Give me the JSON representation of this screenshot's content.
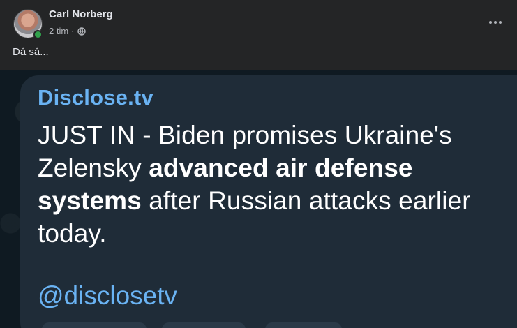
{
  "post": {
    "author": "Carl Norberg",
    "time": "2 tim",
    "separator": "·",
    "privacy_icon": "globe-icon",
    "more_icon": "more-options-icon",
    "text": "Då så..."
  },
  "message": {
    "source": "Disclose.tv",
    "headline_part1": "JUST IN - Biden promises Ukraine's Zelensky ",
    "headline_bold": "advanced air defense systems",
    "headline_part2": " after Russian attacks earlier today.",
    "handle": "@disclosetv"
  },
  "colors": {
    "background": "#242526",
    "chat_background": "#0f1a22",
    "bubble": "#1f2c38",
    "link": "#6ab3f3",
    "online": "#31a24c"
  }
}
